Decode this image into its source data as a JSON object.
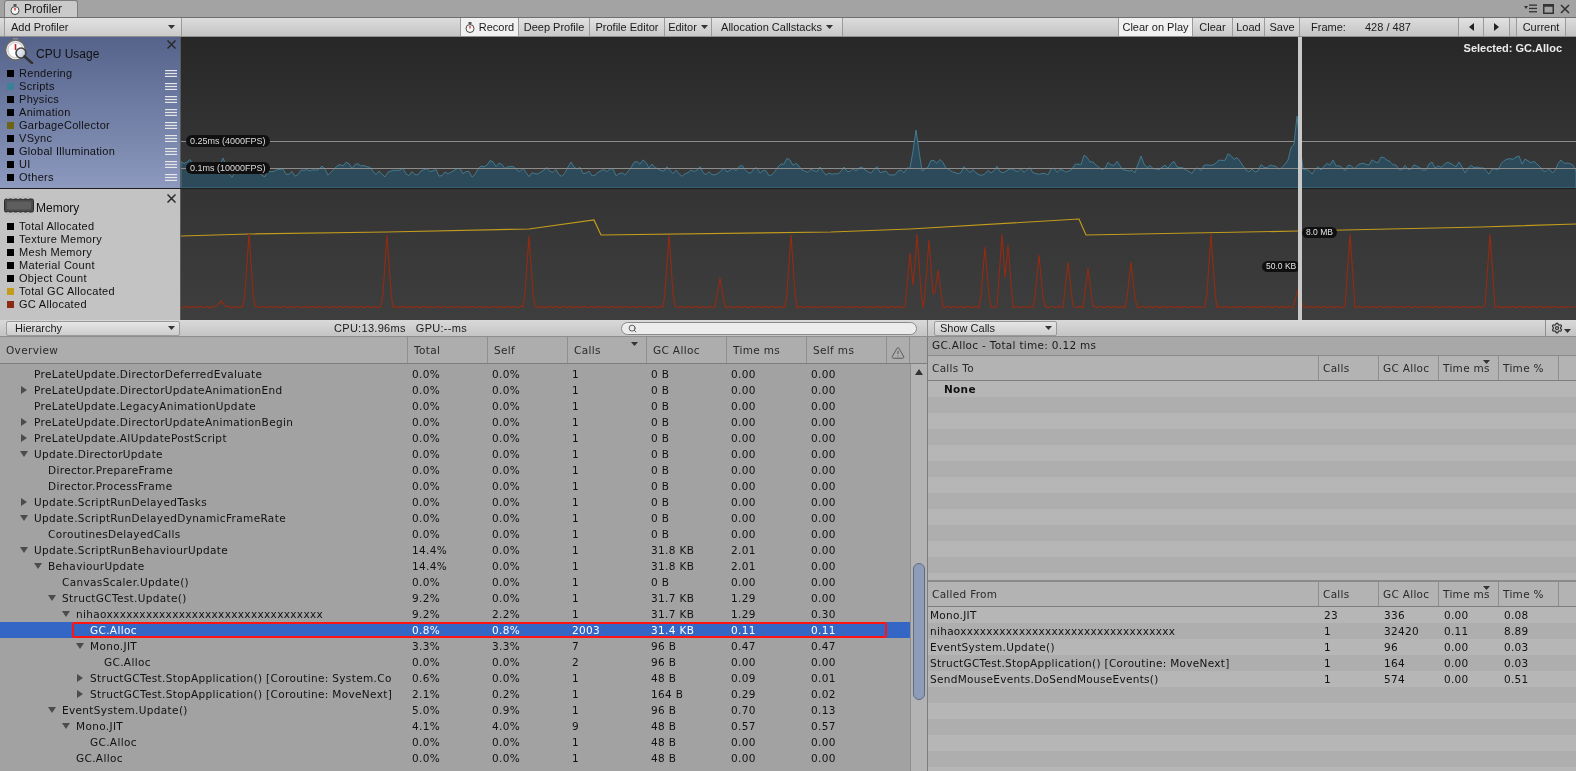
{
  "window": {
    "tab": "Profiler"
  },
  "toolbar": {
    "add_profiler": "Add Profiler",
    "left_buttons": [
      {
        "label": "Record",
        "kind": "record",
        "on": true
      },
      {
        "label": "Deep Profile",
        "kind": "toggle",
        "on": false
      },
      {
        "label": "Profile Editor",
        "kind": "toggle",
        "on": false
      },
      {
        "label": "Editor",
        "kind": "dropdown"
      },
      {
        "label": "Allocation Callstacks",
        "kind": "dropdown"
      }
    ],
    "right_buttons": [
      {
        "label": "Clear on Play",
        "kind": "toggle",
        "on": true
      },
      {
        "label": "Clear",
        "kind": "button"
      },
      {
        "label": "Load",
        "kind": "button"
      },
      {
        "label": "Save",
        "kind": "button"
      }
    ],
    "frame_label": "Frame:",
    "frame_value": "428 / 487",
    "current": "Current"
  },
  "modules": [
    {
      "kind": "cpu",
      "title": "CPU Usage",
      "selected": true,
      "series": [
        {
          "name": "Rendering",
          "color": "#000000"
        },
        {
          "name": "Scripts",
          "color": "#3b8199"
        },
        {
          "name": "Physics",
          "color": "#000000"
        },
        {
          "name": "Animation",
          "color": "#000000"
        },
        {
          "name": "GarbageCollector",
          "color": "#6b6415"
        },
        {
          "name": "VSync",
          "color": "#000000"
        },
        {
          "name": "Global Illumination",
          "color": "#000000"
        },
        {
          "name": "UI",
          "color": "#000000"
        },
        {
          "name": "Others",
          "color": "#000000"
        }
      ],
      "reference_lines": [
        "0.25ms (4000FPS)",
        "0.1ms (10000FPS)"
      ],
      "selection": "Selected: GC.Alloc"
    },
    {
      "kind": "memory",
      "title": "Memory",
      "selected": false,
      "series": [
        {
          "name": "Total Allocated",
          "color": "#000000"
        },
        {
          "name": "Texture Memory",
          "color": "#000000"
        },
        {
          "name": "Mesh Memory",
          "color": "#000000"
        },
        {
          "name": "Material Count",
          "color": "#000000"
        },
        {
          "name": "Object Count",
          "color": "#000000"
        },
        {
          "name": "Total GC Allocated",
          "color": "#c29c1c"
        },
        {
          "name": "GC Allocated",
          "color": "#8a2b12"
        }
      ],
      "value_labels": [
        "8.0 MB",
        "50.0 KB"
      ]
    }
  ],
  "details_toolbar": {
    "view": "Hierarchy",
    "cpu_time": "CPU:13.96ms",
    "gpu_time": "GPU:--ms",
    "calls_view": "Show Calls"
  },
  "hierarchy": {
    "columns": [
      {
        "label": "Overview",
        "sorted": false
      },
      {
        "label": "Total",
        "sorted": false
      },
      {
        "label": "Self",
        "sorted": false
      },
      {
        "label": "Calls",
        "sorted": true
      },
      {
        "label": "GC Alloc",
        "sorted": false
      },
      {
        "label": "Time ms",
        "sorted": false
      },
      {
        "label": "Self ms",
        "sorted": false
      }
    ],
    "rows": [
      {
        "name": "PreLateUpdate.DirectorDeferredEvaluate",
        "kind": "leaf",
        "selected": false,
        "outlined": false,
        "total": "0.0%",
        "self": "0.0%",
        "calls": "1",
        "gc_alloc": "0 B",
        "time_ms": "0.00",
        "self_ms": "0.00"
      },
      {
        "name": "PreLateUpdate.DirectorUpdateAnimationEnd",
        "kind": "node",
        "expanded": false,
        "selected": false,
        "outlined": false,
        "total": "0.0%",
        "self": "0.0%",
        "calls": "1",
        "gc_alloc": "0 B",
        "time_ms": "0.00",
        "self_ms": "0.00"
      },
      {
        "name": "PreLateUpdate.LegacyAnimationUpdate",
        "kind": "leaf",
        "selected": false,
        "outlined": false,
        "total": "0.0%",
        "self": "0.0%",
        "calls": "1",
        "gc_alloc": "0 B",
        "time_ms": "0.00",
        "self_ms": "0.00"
      },
      {
        "name": "PreLateUpdate.DirectorUpdateAnimationBegin",
        "kind": "node",
        "expanded": false,
        "selected": false,
        "outlined": false,
        "total": "0.0%",
        "self": "0.0%",
        "calls": "1",
        "gc_alloc": "0 B",
        "time_ms": "0.00",
        "self_ms": "0.00"
      },
      {
        "name": "PreLateUpdate.AIUpdatePostScript",
        "kind": "node",
        "expanded": false,
        "selected": false,
        "outlined": false,
        "total": "0.0%",
        "self": "0.0%",
        "calls": "1",
        "gc_alloc": "0 B",
        "time_ms": "0.00",
        "self_ms": "0.00"
      },
      {
        "name": "Update.DirectorUpdate",
        "kind": "node",
        "expanded": true,
        "selected": false,
        "outlined": false,
        "total": "0.0%",
        "self": "0.0%",
        "calls": "1",
        "gc_alloc": "0 B",
        "time_ms": "0.00",
        "self_ms": "0.00",
        "children": [
          {
            "name": "Director.PrepareFrame",
            "kind": "leaf",
            "selected": false,
            "outlined": false,
            "total": "0.0%",
            "self": "0.0%",
            "calls": "1",
            "gc_alloc": "0 B",
            "time_ms": "0.00",
            "self_ms": "0.00"
          },
          {
            "name": "Director.ProcessFrame",
            "kind": "leaf",
            "selected": false,
            "outlined": false,
            "total": "0.0%",
            "self": "0.0%",
            "calls": "1",
            "gc_alloc": "0 B",
            "time_ms": "0.00",
            "self_ms": "0.00"
          }
        ]
      },
      {
        "name": "Update.ScriptRunDelayedTasks",
        "kind": "node",
        "expanded": false,
        "selected": false,
        "outlined": false,
        "total": "0.0%",
        "self": "0.0%",
        "calls": "1",
        "gc_alloc": "0 B",
        "time_ms": "0.00",
        "self_ms": "0.00"
      },
      {
        "name": "Update.ScriptRunDelayedDynamicFrameRate",
        "kind": "node",
        "expanded": true,
        "selected": false,
        "outlined": false,
        "total": "0.0%",
        "self": "0.0%",
        "calls": "1",
        "gc_alloc": "0 B",
        "time_ms": "0.00",
        "self_ms": "0.00",
        "children": [
          {
            "name": "CoroutinesDelayedCalls",
            "kind": "leaf",
            "selected": false,
            "outlined": false,
            "total": "0.0%",
            "self": "0.0%",
            "calls": "1",
            "gc_alloc": "0 B",
            "time_ms": "0.00",
            "self_ms": "0.00"
          }
        ]
      },
      {
        "name": "Update.ScriptRunBehaviourUpdate",
        "kind": "node",
        "expanded": true,
        "selected": false,
        "outlined": false,
        "total": "14.4%",
        "self": "0.0%",
        "calls": "1",
        "gc_alloc": "31.8 KB",
        "time_ms": "2.01",
        "self_ms": "0.00",
        "children": [
          {
            "name": "BehaviourUpdate",
            "kind": "node",
            "expanded": true,
            "selected": false,
            "outlined": false,
            "total": "14.4%",
            "self": "0.0%",
            "calls": "1",
            "gc_alloc": "31.8 KB",
            "time_ms": "2.01",
            "self_ms": "0.00",
            "children": [
              {
                "name": "CanvasScaler.Update()",
                "kind": "leaf",
                "selected": false,
                "outlined": false,
                "total": "0.0%",
                "self": "0.0%",
                "calls": "1",
                "gc_alloc": "0 B",
                "time_ms": "0.00",
                "self_ms": "0.00"
              },
              {
                "name": "StructGCTest.Update()",
                "kind": "node",
                "expanded": true,
                "selected": false,
                "outlined": false,
                "total": "9.2%",
                "self": "0.0%",
                "calls": "1",
                "gc_alloc": "31.7 KB",
                "time_ms": "1.29",
                "self_ms": "0.00",
                "children": [
                  {
                    "name": "nihaoxxxxxxxxxxxxxxxxxxxxxxxxxxxxxxxxx",
                    "kind": "node",
                    "expanded": true,
                    "selected": false,
                    "outlined": false,
                    "total": "9.2%",
                    "self": "2.2%",
                    "calls": "1",
                    "gc_alloc": "31.7 KB",
                    "time_ms": "1.29",
                    "self_ms": "0.30",
                    "children": [
                      {
                        "name": "GC.Alloc",
                        "kind": "leaf",
                        "selected": true,
                        "outlined": true,
                        "total": "0.8%",
                        "self": "0.8%",
                        "calls": "2003",
                        "gc_alloc": "31.4 KB",
                        "time_ms": "0.11",
                        "self_ms": "0.11"
                      },
                      {
                        "name": "Mono.JIT",
                        "kind": "node",
                        "expanded": true,
                        "selected": false,
                        "outlined": false,
                        "total": "3.3%",
                        "self": "3.3%",
                        "calls": "7",
                        "gc_alloc": "96 B",
                        "time_ms": "0.47",
                        "self_ms": "0.47",
                        "children": [
                          {
                            "name": "GC.Alloc",
                            "kind": "leaf",
                            "selected": false,
                            "outlined": false,
                            "total": "0.0%",
                            "self": "0.0%",
                            "calls": "2",
                            "gc_alloc": "96 B",
                            "time_ms": "0.00",
                            "self_ms": "0.00"
                          }
                        ]
                      },
                      {
                        "name": "StructGCTest.StopApplication() [Coroutine: System.Co",
                        "kind": "node",
                        "expanded": false,
                        "selected": false,
                        "outlined": false,
                        "total": "0.6%",
                        "self": "0.0%",
                        "calls": "1",
                        "gc_alloc": "48 B",
                        "time_ms": "0.09",
                        "self_ms": "0.01"
                      },
                      {
                        "name": "StructGCTest.StopApplication() [Coroutine: MoveNext]",
                        "kind": "node",
                        "expanded": false,
                        "selected": false,
                        "outlined": false,
                        "total": "2.1%",
                        "self": "0.2%",
                        "calls": "1",
                        "gc_alloc": "164 B",
                        "time_ms": "0.29",
                        "self_ms": "0.02"
                      }
                    ]
                  }
                ]
              },
              {
                "name": "EventSystem.Update()",
                "kind": "node",
                "expanded": true,
                "selected": false,
                "outlined": false,
                "total": "5.0%",
                "self": "0.9%",
                "calls": "1",
                "gc_alloc": "96 B",
                "time_ms": "0.70",
                "self_ms": "0.13",
                "children": [
                  {
                    "name": "Mono.JIT",
                    "kind": "node",
                    "expanded": true,
                    "selected": false,
                    "outlined": false,
                    "total": "4.1%",
                    "self": "4.0%",
                    "calls": "9",
                    "gc_alloc": "48 B",
                    "time_ms": "0.57",
                    "self_ms": "0.57",
                    "children": [
                      {
                        "name": "GC.Alloc",
                        "kind": "leaf",
                        "selected": false,
                        "outlined": false,
                        "total": "0.0%",
                        "self": "0.0%",
                        "calls": "1",
                        "gc_alloc": "48 B",
                        "time_ms": "0.00",
                        "self_ms": "0.00"
                      }
                    ]
                  },
                  {
                    "name": "GC.Alloc",
                    "kind": "leaf",
                    "selected": false,
                    "outlined": false,
                    "total": "0.0%",
                    "self": "0.0%",
                    "calls": "1",
                    "gc_alloc": "48 B",
                    "time_ms": "0.00",
                    "self_ms": "0.00"
                  }
                ]
              }
            ]
          }
        ]
      }
    ]
  },
  "details": {
    "title": "GC.Alloc - Total time: 0.12 ms",
    "calls_to": {
      "columns": [
        {
          "label": "Calls To",
          "sorted": false
        },
        {
          "label": "Calls",
          "sorted": false
        },
        {
          "label": "GC Alloc",
          "sorted": false
        },
        {
          "label": "Time ms",
          "sorted": true
        },
        {
          "label": "Time %",
          "sorted": false
        }
      ],
      "empty_text": "None"
    },
    "called_from": {
      "columns": [
        {
          "label": "Called From",
          "sorted": false
        },
        {
          "label": "Calls",
          "sorted": false
        },
        {
          "label": "GC Alloc",
          "sorted": false
        },
        {
          "label": "Time ms",
          "sorted": true
        },
        {
          "label": "Time %",
          "sorted": false
        }
      ],
      "rows": [
        {
          "name": "Mono.JIT",
          "calls": "23",
          "gc_alloc": "336",
          "time_ms": "0.00",
          "time_pct": "0.08"
        },
        {
          "name": "nihaoxxxxxxxxxxxxxxxxxxxxxxxxxxxxxxxxx",
          "calls": "1",
          "gc_alloc": "32420",
          "time_ms": "0.11",
          "time_pct": "8.89"
        },
        {
          "name": "EventSystem.Update()",
          "calls": "1",
          "gc_alloc": "96",
          "time_ms": "0.00",
          "time_pct": "0.03"
        },
        {
          "name": "StructGCTest.StopApplication() [Coroutine: MoveNext]",
          "calls": "1",
          "gc_alloc": "164",
          "time_ms": "0.00",
          "time_pct": "0.03"
        },
        {
          "name": "SendMouseEvents.DoSendMouseEvents()",
          "calls": "1",
          "gc_alloc": "574",
          "time_ms": "0.00",
          "time_pct": "0.51"
        }
      ]
    }
  }
}
